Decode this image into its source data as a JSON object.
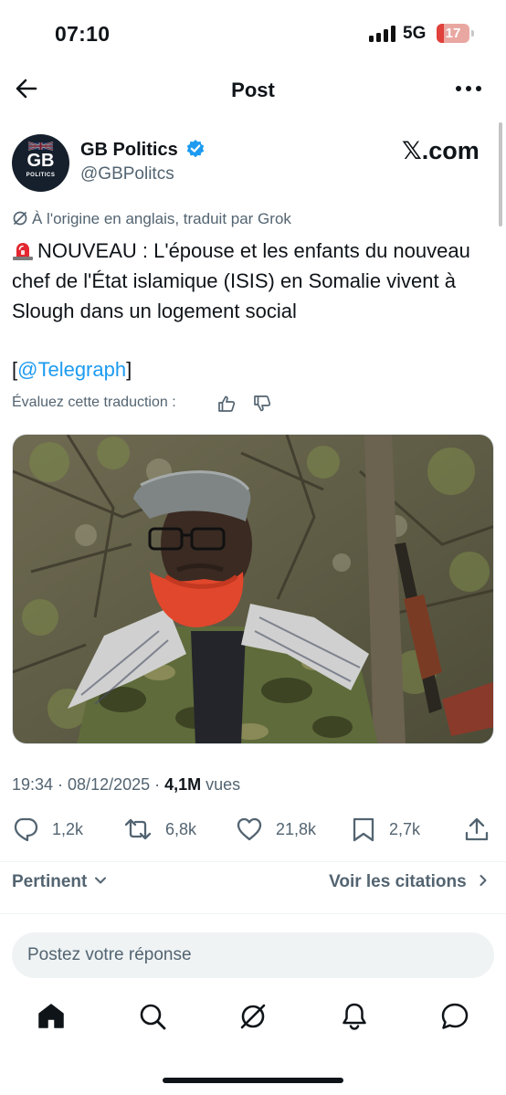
{
  "status_bar": {
    "time": "07:10",
    "network": "5G",
    "battery": "17"
  },
  "header": {
    "title": "Post"
  },
  "author": {
    "avatar_text": "GB",
    "avatar_subtext": "POLITICS",
    "name": "GB Politics",
    "handle": "@GBPolitcs",
    "source_label": "𝕏.com"
  },
  "post": {
    "translation_note": "À l'origine en anglais, traduit par Grok",
    "text": "NOUVEAU : L'épouse et les enfants du nouveau chef de l'État islamique (ISIS) en Somalie vivent à Slough dans un logement social",
    "mention_open": "[",
    "mention": "@Telegraph",
    "mention_close": "]",
    "rate_label": "Évaluez cette traduction :"
  },
  "meta": {
    "datetime": "19:34 · 08/12/2025 · ",
    "views_count": "4,1M",
    "views_label": " vues"
  },
  "actions": {
    "replies": "1,2k",
    "reposts": "6,8k",
    "likes": "21,8k",
    "bookmarks": "2,7k"
  },
  "sort": {
    "label": "Pertinent",
    "citations_label": "Voir les citations"
  },
  "reply": {
    "placeholder": "Postez votre réponse"
  },
  "colors": {
    "accent": "#1d9bf0",
    "text": "#0f1419",
    "secondary": "#536471"
  },
  "tabs": [
    "home-icon",
    "search-icon",
    "grok-icon",
    "notifications-icon",
    "messages-icon"
  ]
}
